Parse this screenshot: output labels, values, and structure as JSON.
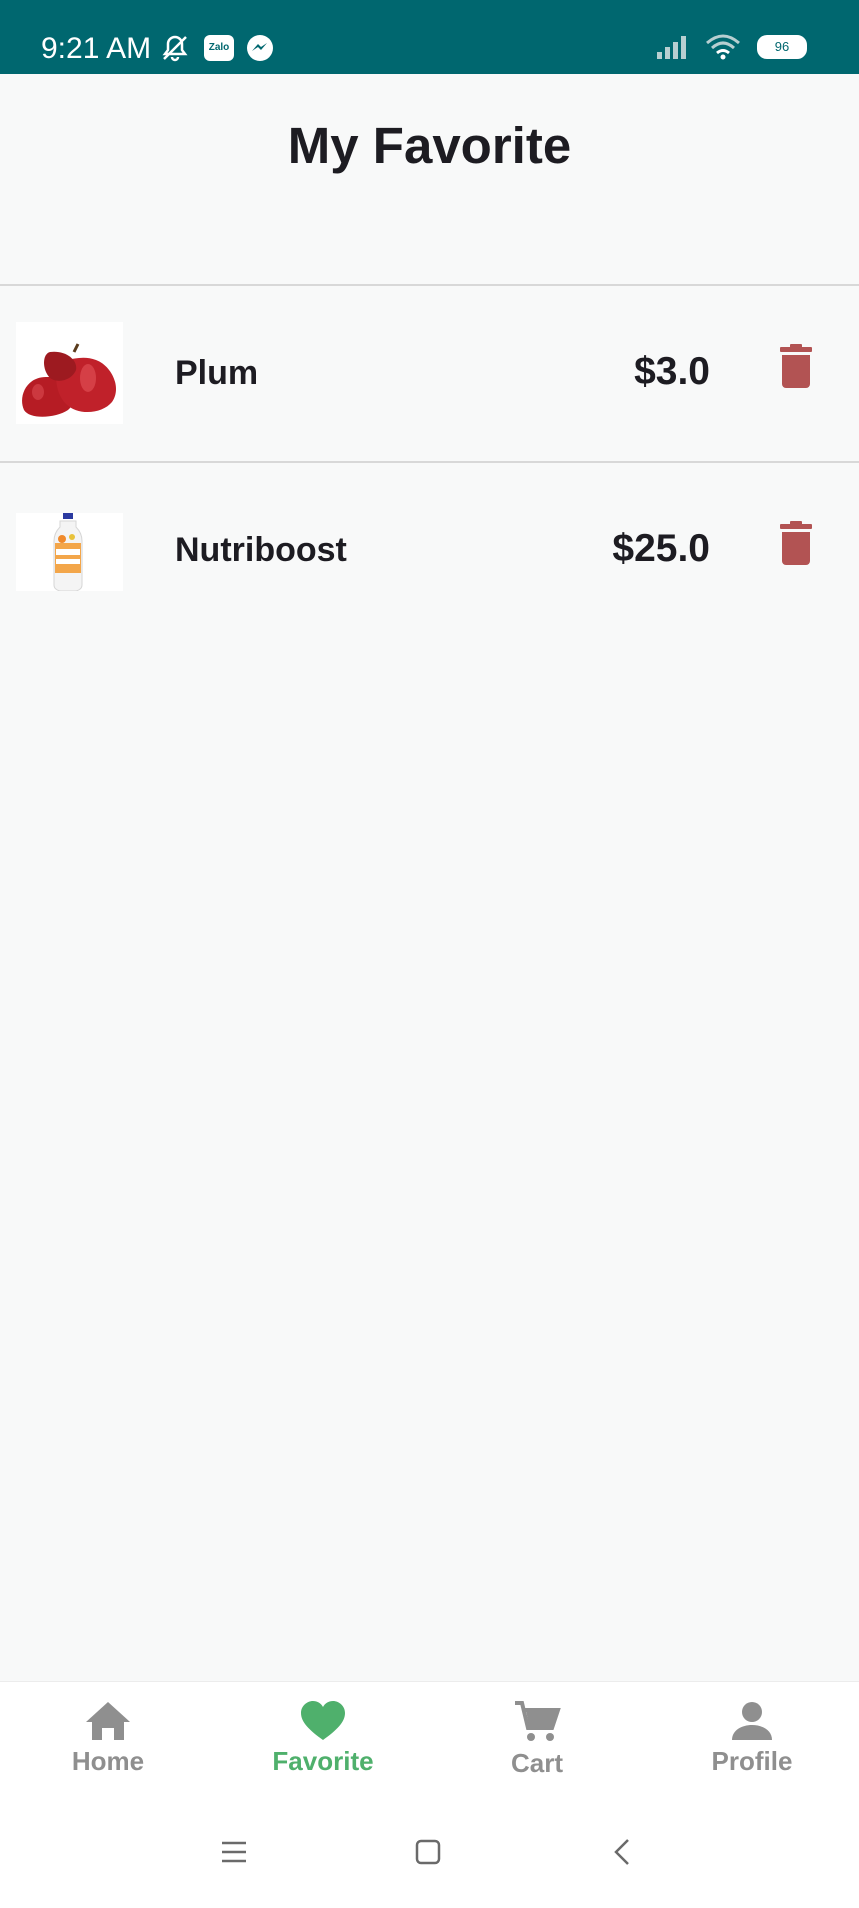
{
  "status_bar": {
    "time": "9:21 AM",
    "battery": "96",
    "zalo_label": "Zalo"
  },
  "header": {
    "title": "My Favorite"
  },
  "favorites": [
    {
      "name": "Plum",
      "price": "$3.0"
    },
    {
      "name": "Nutriboost",
      "price": "$25.0"
    }
  ],
  "bottom_nav": [
    {
      "label": "Home",
      "icon": "home-icon",
      "active": false
    },
    {
      "label": "Favorite",
      "icon": "heart-icon",
      "active": true
    },
    {
      "label": "Cart",
      "icon": "cart-icon",
      "active": false
    },
    {
      "label": "Profile",
      "icon": "person-icon",
      "active": false
    }
  ],
  "colors": {
    "status_bar": "#00676f",
    "accent": "#4fb06c",
    "delete": "#b25353",
    "nav_inactive": "#8f8f8f",
    "text": "#1d1c22"
  }
}
